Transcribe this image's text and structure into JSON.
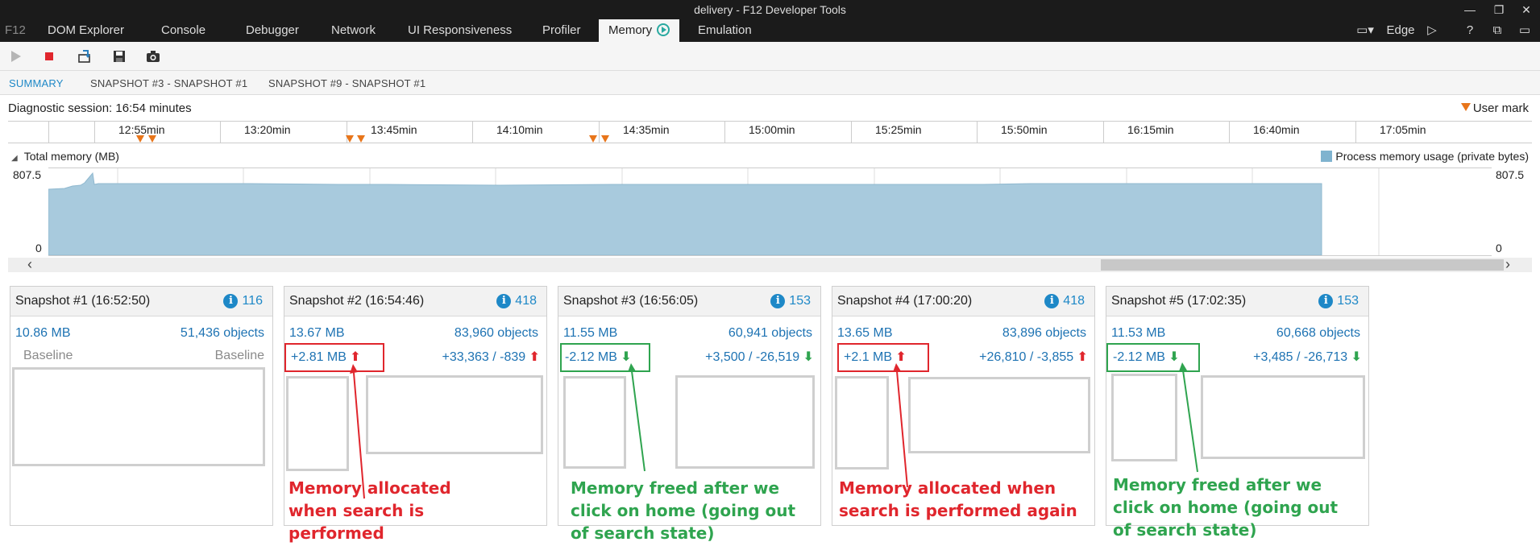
{
  "window": {
    "title": "delivery - F12 Developer Tools"
  },
  "tabs": {
    "f12": "F12",
    "items": [
      "DOM Explorer",
      "Console",
      "Debugger",
      "Network",
      "UI Responsiveness",
      "Profiler",
      "Memory",
      "Emulation"
    ],
    "active": "Memory",
    "browser": "Edge"
  },
  "subtabs": [
    "SUMMARY",
    "SNAPSHOT #3 - SNAPSHOT #1",
    "SNAPSHOT #9 - SNAPSHOT #1"
  ],
  "diagnostic": {
    "label": "Diagnostic session: 16:54 minutes",
    "user_mark": "User mark"
  },
  "timeline": {
    "labels": [
      "12:55min",
      "13:20min",
      "13:45min",
      "14:10min",
      "14:35min",
      "15:00min",
      "15:25min",
      "15:50min",
      "16:15min",
      "16:40min",
      "17:05min"
    ]
  },
  "memory_graph": {
    "title": "Total memory (MB)",
    "legend": "Process memory usage (private bytes)",
    "ymax": "807.5",
    "ymin": "0",
    "color": "#a8cadd"
  },
  "snapshots": [
    {
      "title": "Snapshot #1",
      "time": "(16:52:50)",
      "count": "116",
      "size": "10.86 MB",
      "objects": "51,436 objects",
      "baseline_left": "Baseline",
      "baseline_right": "Baseline"
    },
    {
      "title": "Snapshot #2",
      "time": "(16:54:46)",
      "count": "418",
      "size": "13.67 MB",
      "objects": "83,960 objects",
      "delta_size": "+2.81 MB",
      "delta_objects": "+33,363 / -839",
      "dir": "up"
    },
    {
      "title": "Snapshot #3",
      "time": "(16:56:05)",
      "count": "153",
      "size": "11.55 MB",
      "objects": "60,941 objects",
      "delta_size": "-2.12 MB",
      "delta_objects": "+3,500 / -26,519",
      "dir": "down"
    },
    {
      "title": "Snapshot #4",
      "time": "(17:00:20)",
      "count": "418",
      "size": "13.65 MB",
      "objects": "83,896 objects",
      "delta_size": "+2.1 MB",
      "delta_objects": "+26,810 / -3,855",
      "dir": "up"
    },
    {
      "title": "Snapshot #5",
      "time": "(17:02:35)",
      "count": "153",
      "size": "11.53 MB",
      "objects": "60,668 objects",
      "delta_size": "-2.12 MB",
      "delta_objects": "+3,485 / -26,713",
      "dir": "down"
    }
  ],
  "annotations": [
    "Memory allocated when search is performed",
    "Memory freed after we click on home (going out of search state)",
    "Memory allocated when search is performed again",
    "Memory freed after we click on home (going out of search state)"
  ]
}
